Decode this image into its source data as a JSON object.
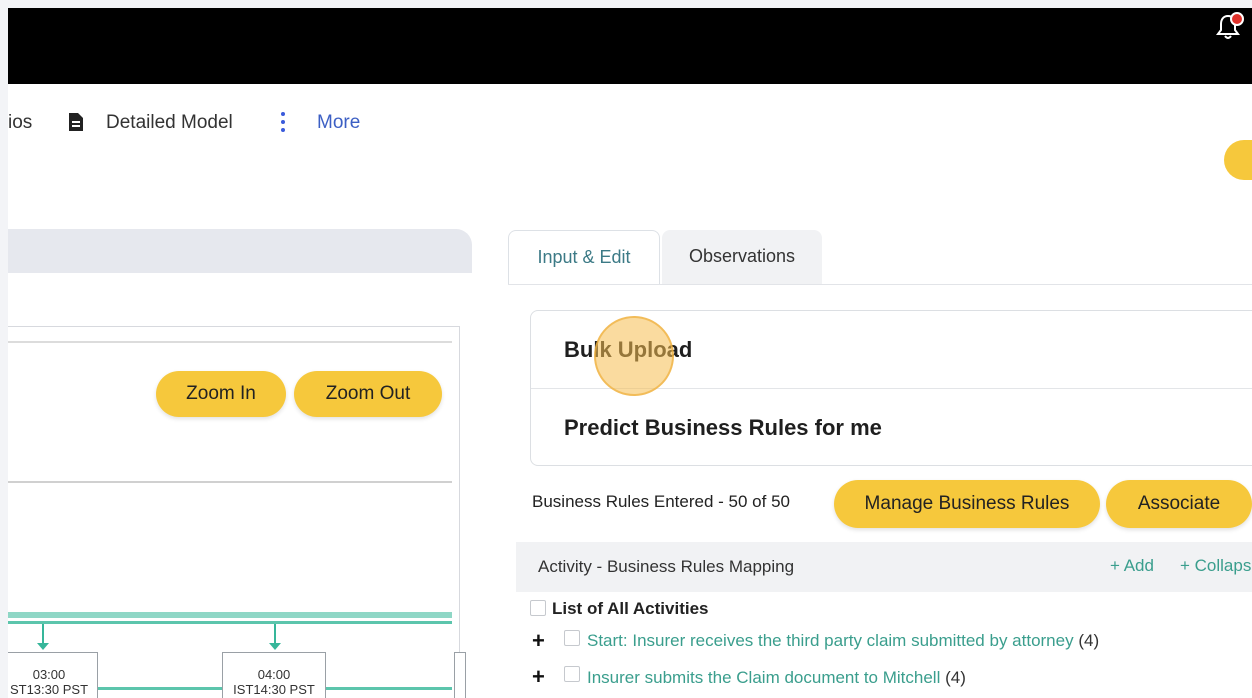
{
  "topbar": {
    "bell_icon": "bell-icon",
    "badge_color": "#e0312a"
  },
  "nav": {
    "scenarios_partial": "ios",
    "detailed_model_label": "Detailed Model",
    "more_label": "More"
  },
  "canvas": {
    "zoom_in_label": "Zoom In",
    "zoom_out_label": "Zoom Out",
    "nodes": [
      {
        "time": "03:00",
        "subtitle": "ST13:30 PST"
      },
      {
        "time": "04:00",
        "subtitle": "IST14:30 PST"
      }
    ]
  },
  "tabs": [
    {
      "label": "Input & Edit",
      "active": true
    },
    {
      "label": "Observations",
      "active": false
    }
  ],
  "actions": {
    "bulk_upload_label": "Bulk Upload",
    "predict_label": "Predict Business Rules for me"
  },
  "rules": {
    "count_text": "Business Rules Entered - 50 of 50",
    "manage_label": "Manage Business Rules",
    "associate_label": "Associate"
  },
  "mapping": {
    "title": "Activity - Business Rules Mapping",
    "add_label": "+ Add",
    "collapse_label": "+ Collapse"
  },
  "activities": {
    "list_all_label": "List of All Activities",
    "items": [
      {
        "text": "Start: Insurer receives the third party claim submitted by attorney",
        "count": "(4)"
      },
      {
        "text": "Insurer submits the Claim document to Mitchell",
        "count": "(4)"
      }
    ]
  },
  "colors": {
    "accent_yellow": "#f6c83c",
    "teal_link": "#3a9e8d",
    "nav_blue": "#3c5fc4"
  }
}
